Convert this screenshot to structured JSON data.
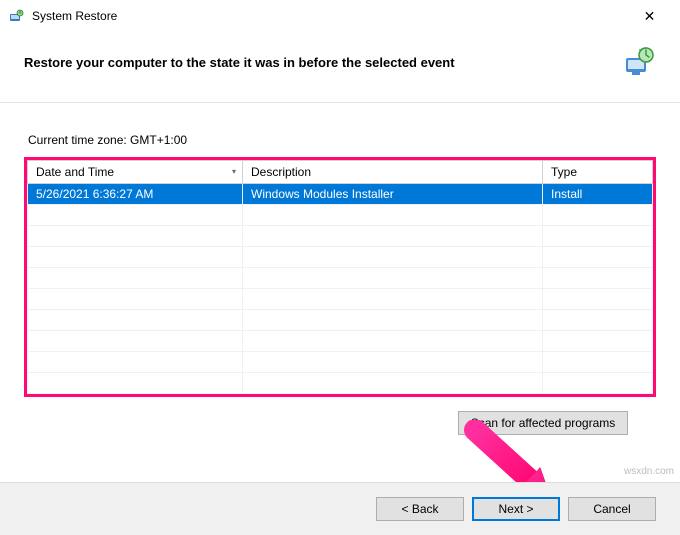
{
  "window": {
    "title": "System Restore",
    "close_label": "✕"
  },
  "header": {
    "headline": "Restore your computer to the state it was in before the selected event"
  },
  "timezone": {
    "label": "Current time zone: GMT+1:00"
  },
  "table": {
    "columns": {
      "datetime": "Date and Time",
      "description": "Description",
      "type": "Type"
    },
    "rows": [
      {
        "datetime": "5/26/2021 6:36:27 AM",
        "description": "Windows Modules Installer",
        "type": "Install",
        "selected": true
      }
    ],
    "empty_rows": 9
  },
  "buttons": {
    "scan": "Scan for affected programs",
    "back": "< Back",
    "next": "Next >",
    "cancel": "Cancel"
  },
  "watermark": "wsxdn.com",
  "colors": {
    "accent": "#0078d7",
    "highlight": "#ff0a74"
  }
}
